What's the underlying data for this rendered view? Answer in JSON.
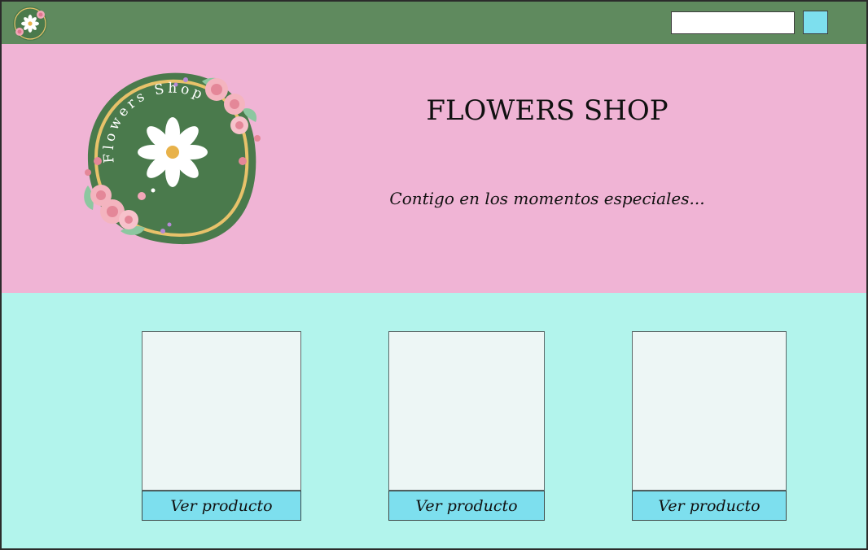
{
  "colors": {
    "topbar": "#5f8a5e",
    "hero": "#f0b4d5",
    "products_bg": "#b2f4ec",
    "button": "#7ddfee",
    "logo_green": "#4a7a4c",
    "logo_ring": "#e8c26a"
  },
  "topbar": {
    "logo_icon": "flowers-shop-logo",
    "search": {
      "value": "",
      "placeholder": ""
    },
    "search_button_icon": "square-button"
  },
  "hero": {
    "logo_text": "Flowers Shop",
    "title": "FLOWERS SHOP",
    "tagline": "Contigo en los momentos especiales..."
  },
  "products": [
    {
      "button_label": "Ver producto"
    },
    {
      "button_label": "Ver producto"
    },
    {
      "button_label": "Ver producto"
    }
  ]
}
